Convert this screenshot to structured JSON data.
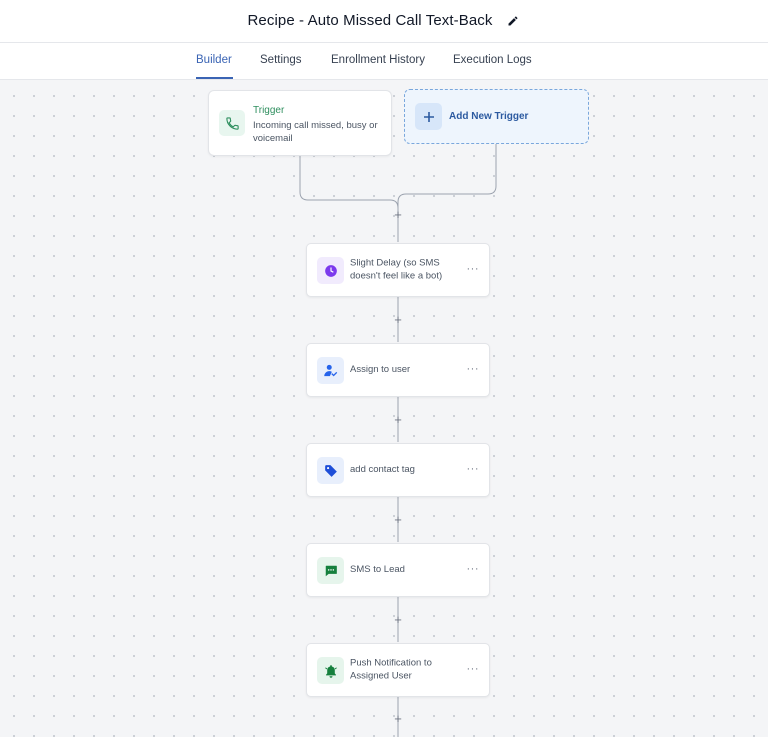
{
  "header": {
    "title": "Recipe - Auto Missed Call Text-Back",
    "edit_icon": "pencil-icon"
  },
  "tabs": [
    {
      "label": "Builder",
      "active": true
    },
    {
      "label": "Settings",
      "active": false
    },
    {
      "label": "Enrollment History",
      "active": false
    },
    {
      "label": "Execution Logs",
      "active": false
    }
  ],
  "trigger": {
    "label": "Trigger",
    "description": "Incoming call missed, busy or voicemail",
    "icon": "phone-icon"
  },
  "add_trigger": {
    "label": "Add New Trigger",
    "icon": "plus-icon"
  },
  "steps": [
    {
      "label": "Slight Delay (so SMS doesn't feel like a bot)",
      "icon": "clock-icon",
      "more": "···"
    },
    {
      "label": "Assign to user",
      "icon": "assign-user-icon",
      "more": "···"
    },
    {
      "label": "add contact tag",
      "icon": "tag-icon",
      "more": "···"
    },
    {
      "label": "SMS to Lead",
      "icon": "sms-icon",
      "more": "···"
    },
    {
      "label": "Push Notification to Assigned User",
      "icon": "bell-icon",
      "more": "···"
    }
  ],
  "add_step_symbol": "+",
  "colors": {
    "accent": "#3a64b4",
    "trigger_green": "#2f8f5f",
    "delay_purple": "#7c3aed",
    "assign_blue": "#2563eb",
    "tag_blue": "#1d4ed8",
    "sms_green": "#15803d",
    "bell_green": "#15803d"
  }
}
